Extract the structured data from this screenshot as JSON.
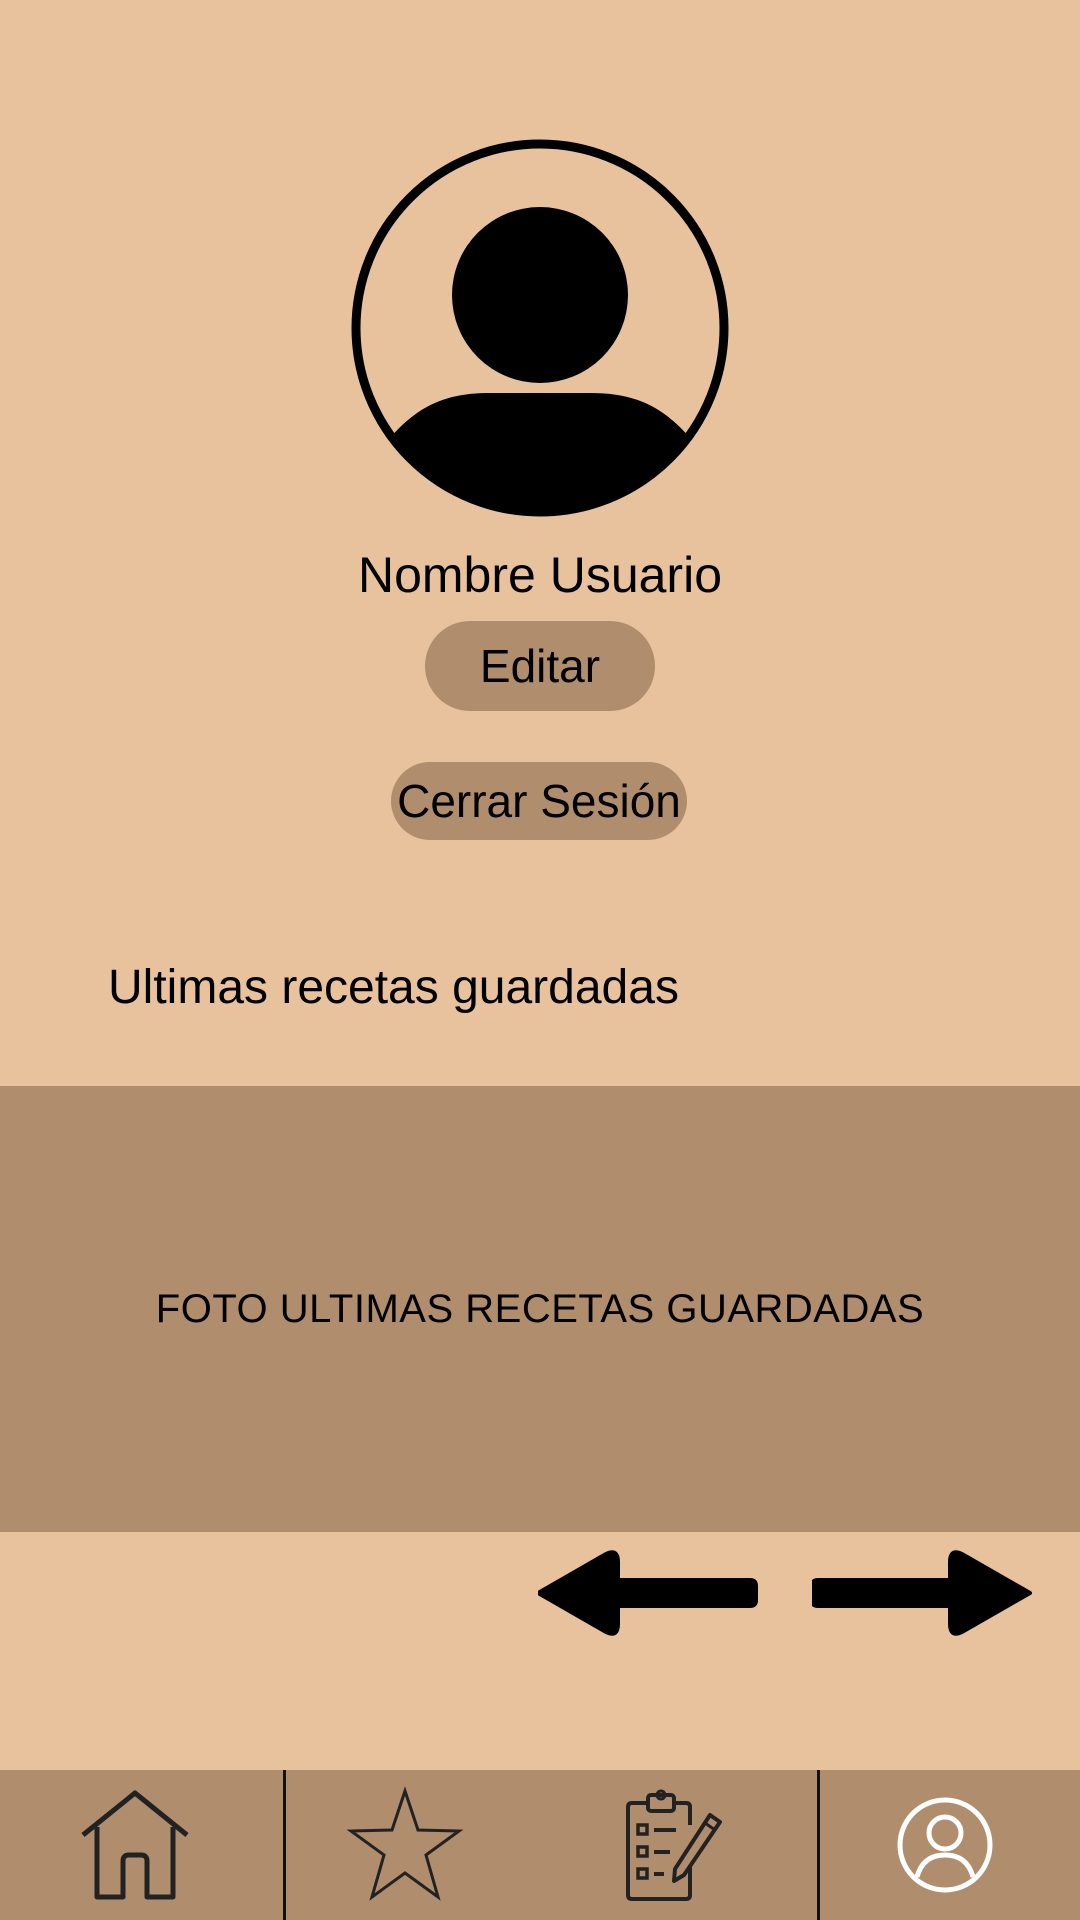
{
  "profile": {
    "avatar_icon": "user-avatar-icon",
    "username": "Nombre Usuario",
    "edit_label": "Editar",
    "logout_label": "Cerrar Sesión"
  },
  "saved": {
    "title": "Ultimas recetas guardadas",
    "photo_placeholder": "FOTO ULTIMAS RECETAS GUARDADAS",
    "prev_icon": "arrow-left-icon",
    "next_icon": "arrow-right-icon"
  },
  "navbar": {
    "items": [
      {
        "icon": "home-icon"
      },
      {
        "icon": "star-icon"
      },
      {
        "icon": "clipboard-edit-icon"
      },
      {
        "icon": "profile-icon"
      }
    ]
  },
  "colors": {
    "background": "#e8c29d",
    "accent": "#b08d6c"
  }
}
